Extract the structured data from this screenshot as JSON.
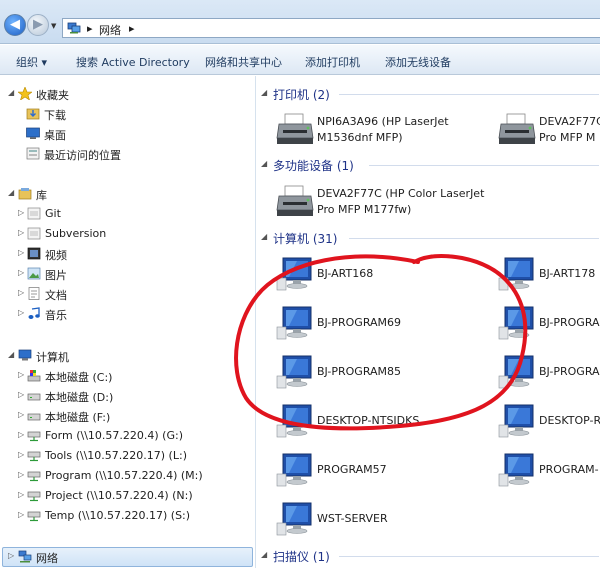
{
  "address": {
    "root_arrow": "▸",
    "location": "网络",
    "trail_arrow": "▸"
  },
  "toolbar": {
    "organize": "组织 ▾",
    "search_ad": "搜索 Active Directory",
    "network_sharing": "网络和共享中心",
    "add_printer": "添加打印机",
    "add_wireless": "添加无线设备"
  },
  "nav": {
    "favorites": {
      "label": "收藏夹",
      "items": [
        "下载",
        "桌面",
        "最近访问的位置"
      ]
    },
    "libraries": {
      "label": "库",
      "items": [
        "Git",
        "Subversion",
        "视频",
        "图片",
        "文档",
        "音乐"
      ]
    },
    "computer": {
      "label": "计算机",
      "items": [
        "本地磁盘 (C:)",
        "本地磁盘 (D:)",
        "本地磁盘 (F:)",
        "Form (\\\\10.57.220.4) (G:)",
        "Tools (\\\\10.57.220.17) (L:)",
        "Program (\\\\10.57.220.4) (M:)",
        "Project (\\\\10.57.220.4) (N:)",
        "Temp (\\\\10.57.220.17) (S:)"
      ]
    },
    "network": {
      "label": "网络"
    }
  },
  "groups": {
    "printers": {
      "header": "打印机 (2)",
      "items": [
        [
          "NPI6A3A96 (HP LaserJet",
          "M1536dnf MFP)"
        ],
        [
          "DEVA2F77C",
          "Pro MFP M"
        ]
      ]
    },
    "multifunction": {
      "header": "多功能设备 (1)",
      "items": [
        [
          "DEVA2F77C (HP Color LaserJet",
          "Pro MFP M177fw)"
        ]
      ]
    },
    "computers": {
      "header": "计算机 (31)",
      "items": [
        "BJ-ART168",
        "BJ-ART178",
        "BJ-PROGRAM69",
        "BJ-PROGRA",
        "BJ-PROGRAM85",
        "BJ-PROGRA",
        "DESKTOP-NTSIDKS",
        "DESKTOP-R",
        "PROGRAM57",
        "PROGRAM-",
        "WST-SERVER"
      ]
    },
    "scanners": {
      "header": "扫描仪 (1)"
    }
  },
  "colors": {
    "annotation": "#e0141e",
    "group_header": "#1e3287",
    "selection": "#cfe3f7"
  }
}
